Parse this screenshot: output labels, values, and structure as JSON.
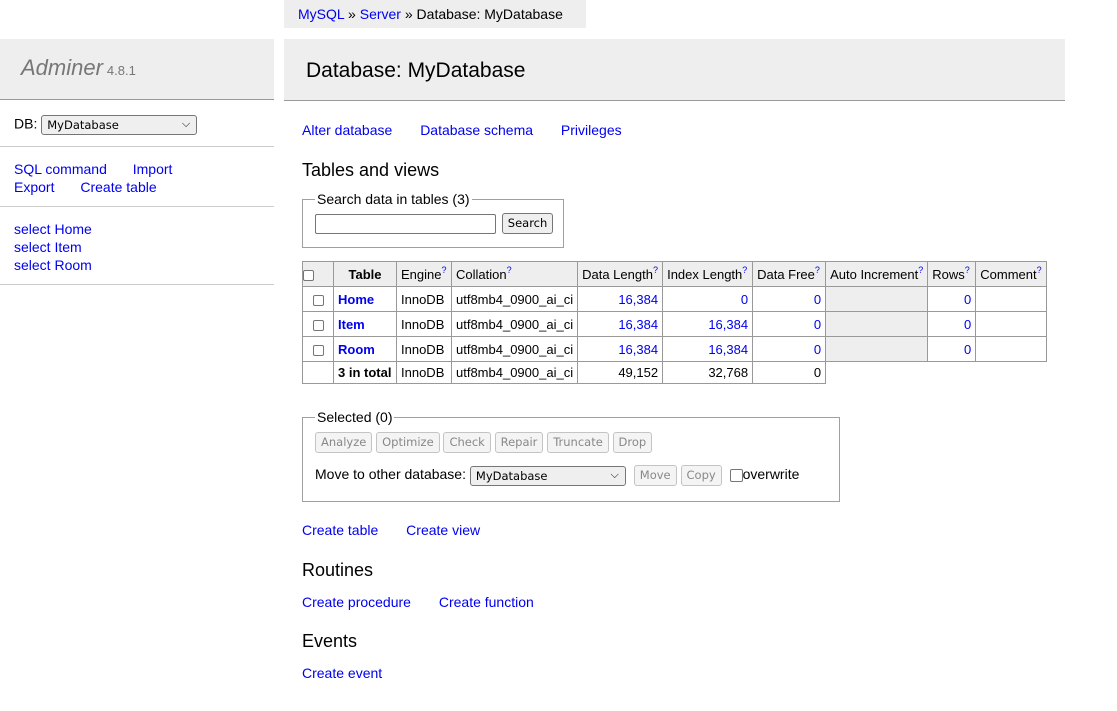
{
  "breadcrumb": {
    "mysql": "MySQL",
    "sep1": "»",
    "server": "Server",
    "sep2": "»",
    "current": "Database: MyDatabase"
  },
  "menu": {
    "logo": "Adminer",
    "version": "4.8.1",
    "db_label": "DB:",
    "db_selected": "MyDatabase",
    "links": [
      "SQL command",
      "Import",
      "Export",
      "Create table"
    ],
    "tables": [
      "select Home",
      "select Item",
      "select Room"
    ]
  },
  "content": {
    "title": "Database: MyDatabase",
    "top_links": [
      "Alter database",
      "Database schema",
      "Privileges"
    ],
    "tables_heading": "Tables and views",
    "search_legend": "Search data in tables (3)",
    "search_value": "",
    "search_button": "Search",
    "columns": {
      "table": "Table",
      "engine": "Engine",
      "collation": "Collation",
      "data_length": "Data Length",
      "index_length": "Index Length",
      "data_free": "Data Free",
      "auto_increment": "Auto Increment",
      "rows": "Rows",
      "comment": "Comment",
      "help": "?"
    },
    "rows": [
      {
        "name": "Home",
        "engine": "InnoDB",
        "collation": "utf8mb4_0900_ai_ci",
        "data_length": "16,384",
        "index_length": "0",
        "data_free": "0",
        "auto_increment": "",
        "rows": "0",
        "comment": ""
      },
      {
        "name": "Item",
        "engine": "InnoDB",
        "collation": "utf8mb4_0900_ai_ci",
        "data_length": "16,384",
        "index_length": "16,384",
        "data_free": "0",
        "auto_increment": "",
        "rows": "0",
        "comment": ""
      },
      {
        "name": "Room",
        "engine": "InnoDB",
        "collation": "utf8mb4_0900_ai_ci",
        "data_length": "16,384",
        "index_length": "16,384",
        "data_free": "0",
        "auto_increment": "",
        "rows": "0",
        "comment": ""
      }
    ],
    "total": {
      "label": "3 in total",
      "engine": "InnoDB",
      "collation": "utf8mb4_0900_ai_ci",
      "data_length": "49,152",
      "index_length": "32,768",
      "data_free": "0"
    },
    "selected_legend": "Selected (0)",
    "actions": [
      "Analyze",
      "Optimize",
      "Check",
      "Repair",
      "Truncate",
      "Drop"
    ],
    "move_label": "Move to other database:",
    "move_db": "MyDatabase",
    "move_button": "Move",
    "copy_button": "Copy",
    "overwrite_label": "overwrite",
    "create_links": [
      "Create table",
      "Create view"
    ],
    "routines_heading": "Routines",
    "routine_links": [
      "Create procedure",
      "Create function"
    ],
    "events_heading": "Events",
    "event_links": [
      "Create event"
    ]
  }
}
